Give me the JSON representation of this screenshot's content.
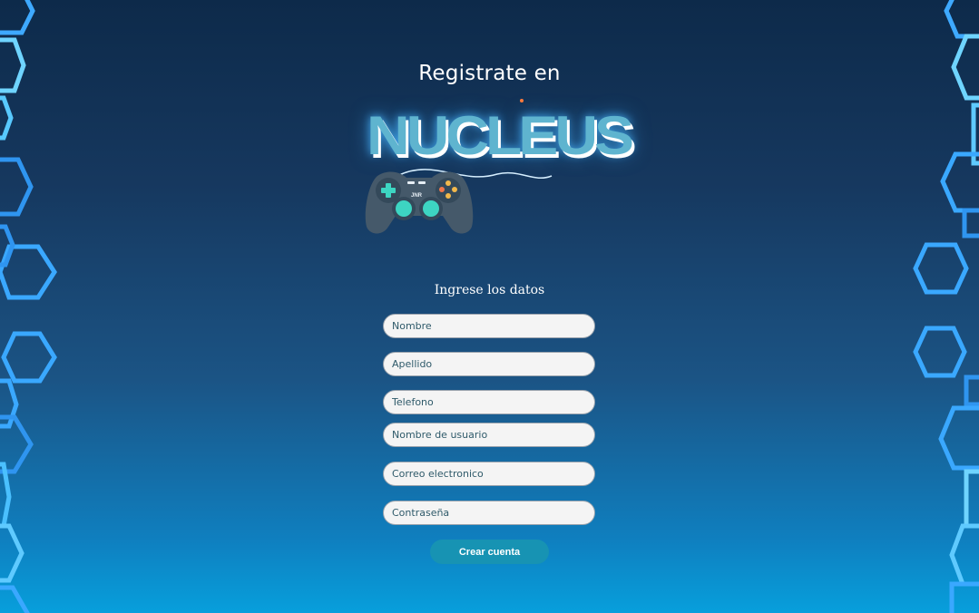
{
  "header": {
    "title": "Registrate en",
    "logo_text": "NUCLEUS",
    "logo_badge": "JNR"
  },
  "form": {
    "heading": "Ingrese los datos",
    "fields": [
      {
        "placeholder": "Nombre",
        "value": ""
      },
      {
        "placeholder": "Apellido",
        "value": ""
      },
      {
        "placeholder": "Telefono",
        "value": ""
      },
      {
        "placeholder": "Nombre de usuario",
        "value": ""
      },
      {
        "placeholder": "Correo electronico",
        "value": ""
      },
      {
        "placeholder": "Contraseña",
        "value": ""
      }
    ],
    "submit_label": "Crear cuenta"
  },
  "colors": {
    "background_top": "#0d2a4a",
    "background_bottom": "#079fdc",
    "accent": "#1793b3",
    "hexagon_outline": "#3aa8ff"
  }
}
